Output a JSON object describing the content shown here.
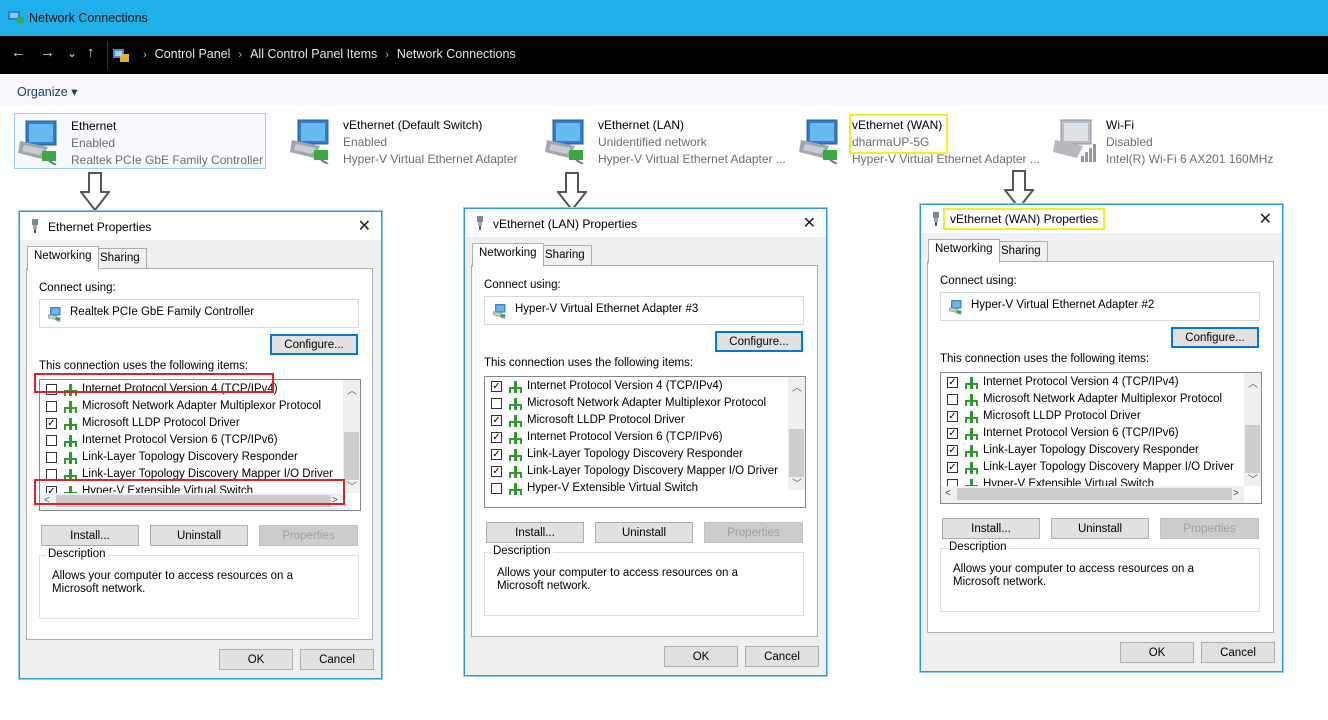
{
  "window": {
    "title": "Network Connections"
  },
  "address": {
    "nav_back": "←",
    "nav_forward": "→",
    "nav_recent": "⌄",
    "nav_up": "↑",
    "crumbs": [
      "Control Panel",
      "All Control Panel Items",
      "Network Connections"
    ],
    "separator": "›"
  },
  "toolbar": {
    "organize": "Organize ▾"
  },
  "connections": [
    {
      "name": "Ethernet",
      "status": "Enabled",
      "adapter": "Realtek PCIe GbE Family Controller"
    },
    {
      "name": "vEthernet (Default Switch)",
      "status": "Enabled",
      "adapter": "Hyper-V Virtual Ethernet Adapter"
    },
    {
      "name": "vEthernet (LAN)",
      "status": "Unidentified network",
      "adapter": "Hyper-V Virtual Ethernet Adapter ..."
    },
    {
      "name": "vEthernet (WAN)",
      "status": "dharmaUP-5G",
      "adapter": "Hyper-V Virtual Ethernet Adapter ..."
    },
    {
      "name": "Wi-Fi",
      "status": "Disabled",
      "adapter": "Intel(R) Wi-Fi 6 AX201 160MHz"
    }
  ],
  "common": {
    "tab_networking": "Networking",
    "tab_sharing": "Sharing",
    "connect_using": "Connect using:",
    "configure": "Configure...",
    "items_label": "This connection uses the following items:",
    "install": "Install...",
    "uninstall": "Uninstall",
    "properties": "Properties",
    "description_legend": "Description",
    "description_text": "Allows your computer to access resources on a Microsoft network.",
    "ok": "OK",
    "cancel": "Cancel",
    "close": "✕",
    "check": "✓",
    "scroll_up": "︿",
    "scroll_down": "﹀",
    "scroll_left": "<",
    "scroll_right": ">"
  },
  "dialogs": [
    {
      "title": "Ethernet Properties",
      "adapter": "Realtek PCIe GbE Family Controller",
      "items": [
        {
          "label": "Internet Protocol Version 4 (TCP/IPv4)",
          "checked": false
        },
        {
          "label": "Microsoft Network Adapter Multiplexor Protocol",
          "checked": false
        },
        {
          "label": "Microsoft LLDP Protocol Driver",
          "checked": true
        },
        {
          "label": "Internet Protocol Version 6 (TCP/IPv6)",
          "checked": false
        },
        {
          "label": "Link-Layer Topology Discovery Responder",
          "checked": false
        },
        {
          "label": "Link-Layer Topology Discovery Mapper I/O Driver",
          "checked": false
        },
        {
          "label": "Hyper-V Extensible Virtual Switch",
          "checked": true
        }
      ]
    },
    {
      "title": "vEthernet (LAN) Properties",
      "adapter": "Hyper-V Virtual Ethernet Adapter #3",
      "items": [
        {
          "label": "Internet Protocol Version 4 (TCP/IPv4)",
          "checked": true
        },
        {
          "label": "Microsoft Network Adapter Multiplexor Protocol",
          "checked": false
        },
        {
          "label": "Microsoft LLDP Protocol Driver",
          "checked": true
        },
        {
          "label": "Internet Protocol Version 6 (TCP/IPv6)",
          "checked": true
        },
        {
          "label": "Link-Layer Topology Discovery Responder",
          "checked": true
        },
        {
          "label": "Link-Layer Topology Discovery Mapper I/O Driver",
          "checked": true
        },
        {
          "label": "Hyper-V Extensible Virtual Switch",
          "checked": false
        }
      ]
    },
    {
      "title": "vEthernet (WAN) Properties",
      "adapter": "Hyper-V Virtual Ethernet Adapter #2",
      "items": [
        {
          "label": "Internet Protocol Version 4 (TCP/IPv4)",
          "checked": true
        },
        {
          "label": "Microsoft Network Adapter Multiplexor Protocol",
          "checked": false
        },
        {
          "label": "Microsoft LLDP Protocol Driver",
          "checked": true
        },
        {
          "label": "Internet Protocol Version 6 (TCP/IPv6)",
          "checked": true
        },
        {
          "label": "Link-Layer Topology Discovery Responder",
          "checked": true
        },
        {
          "label": "Link-Layer Topology Discovery Mapper I/O Driver",
          "checked": true
        },
        {
          "label": "Hyper-V Extensible Virtual Switch",
          "checked": false
        }
      ]
    }
  ]
}
